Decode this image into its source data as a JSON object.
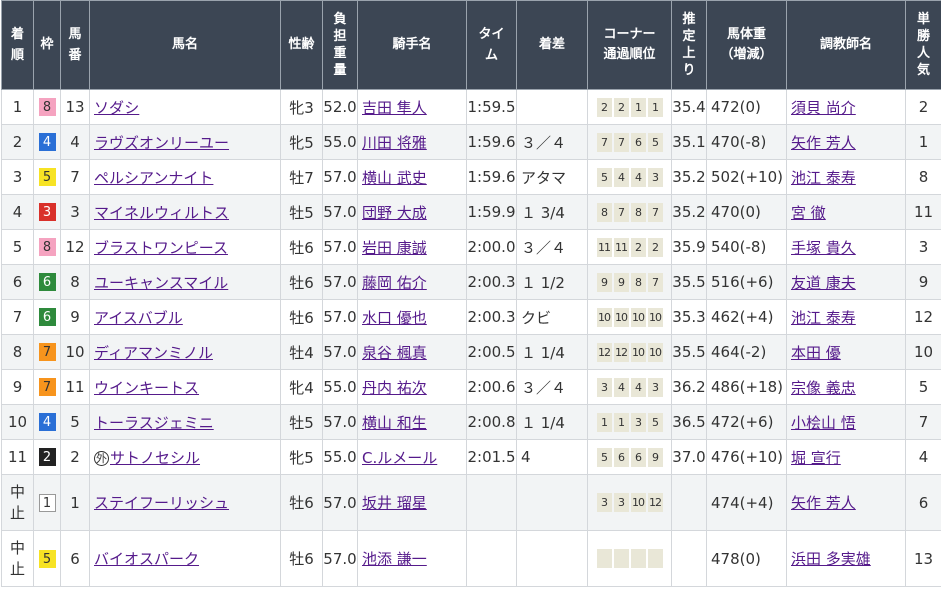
{
  "headers": {
    "chakujun": [
      "着",
      "順"
    ],
    "waku": "枠",
    "umaban": [
      "馬",
      "番"
    ],
    "bamei": "馬名",
    "seirei": "性齢",
    "futan": [
      "負",
      "担",
      "重",
      "量"
    ],
    "kishu": "騎手名",
    "time": [
      "タイ",
      "ム"
    ],
    "chakusa": "着差",
    "corner": [
      "コーナー",
      "通過順位"
    ],
    "agari": [
      "推",
      "定",
      "上",
      "り"
    ],
    "bataiju": [
      "馬体重",
      "（増減）"
    ],
    "chokyoshi": "調教師名",
    "ninki": [
      "単",
      "勝",
      "人",
      "気"
    ]
  },
  "rows": [
    {
      "chakujun": "1",
      "waku": "8",
      "umaban": "13",
      "mark": "",
      "bamei": "ソダシ",
      "seirei": "牝3",
      "futan": "52.0",
      "kishu": "吉田 隼人",
      "time": "1:59.5",
      "chakusa": "",
      "corner": [
        "2",
        "2",
        "1",
        "1"
      ],
      "agari": "35.4",
      "bataiju": "472(0)",
      "chokyoshi": "須貝 尚介",
      "ninki": "2"
    },
    {
      "chakujun": "2",
      "waku": "4",
      "umaban": "4",
      "mark": "",
      "bamei": "ラヴズオンリーユー",
      "seirei": "牝5",
      "futan": "55.0",
      "kishu": "川田 将雅",
      "time": "1:59.6",
      "chakusa": "３／４",
      "corner": [
        "7",
        "7",
        "6",
        "5"
      ],
      "agari": "35.1",
      "bataiju": "470(-8)",
      "chokyoshi": "矢作 芳人",
      "ninki": "1"
    },
    {
      "chakujun": "3",
      "waku": "5",
      "umaban": "7",
      "mark": "",
      "bamei": "ペルシアンナイト",
      "seirei": "牡7",
      "futan": "57.0",
      "kishu": "横山 武史",
      "time": "1:59.6",
      "chakusa": "アタマ",
      "corner": [
        "5",
        "4",
        "4",
        "3"
      ],
      "agari": "35.2",
      "bataiju": "502(+10)",
      "chokyoshi": "池江 泰寿",
      "ninki": "8"
    },
    {
      "chakujun": "4",
      "waku": "3",
      "umaban": "3",
      "mark": "",
      "bamei": "マイネルウィルトス",
      "seirei": "牡5",
      "futan": "57.0",
      "kishu": "団野 大成",
      "time": "1:59.9",
      "chakusa": "１ 3/4",
      "corner": [
        "8",
        "7",
        "8",
        "7"
      ],
      "agari": "35.2",
      "bataiju": "470(0)",
      "chokyoshi": "宮 徹",
      "ninki": "11"
    },
    {
      "chakujun": "5",
      "waku": "8",
      "umaban": "12",
      "mark": "",
      "bamei": "ブラストワンピース",
      "seirei": "牡6",
      "futan": "57.0",
      "kishu": "岩田 康誠",
      "time": "2:00.0",
      "chakusa": "３／４",
      "corner": [
        "11",
        "11",
        "2",
        "2"
      ],
      "agari": "35.9",
      "bataiju": "540(-8)",
      "chokyoshi": "手塚 貴久",
      "ninki": "3"
    },
    {
      "chakujun": "6",
      "waku": "6",
      "umaban": "8",
      "mark": "",
      "bamei": "ユーキャンスマイル",
      "seirei": "牡6",
      "futan": "57.0",
      "kishu": "藤岡 佑介",
      "time": "2:00.3",
      "chakusa": "１ 1/2",
      "corner": [
        "9",
        "9",
        "8",
        "7"
      ],
      "agari": "35.5",
      "bataiju": "516(+6)",
      "chokyoshi": "友道 康夫",
      "ninki": "9"
    },
    {
      "chakujun": "7",
      "waku": "6",
      "umaban": "9",
      "mark": "",
      "bamei": "アイスバブル",
      "seirei": "牡6",
      "futan": "57.0",
      "kishu": "水口 優也",
      "time": "2:00.3",
      "chakusa": "クビ",
      "corner": [
        "10",
        "10",
        "10",
        "10"
      ],
      "agari": "35.3",
      "bataiju": "462(+4)",
      "chokyoshi": "池江 泰寿",
      "ninki": "12"
    },
    {
      "chakujun": "8",
      "waku": "7",
      "umaban": "10",
      "mark": "",
      "bamei": "ディアマンミノル",
      "seirei": "牡4",
      "futan": "57.0",
      "kishu": "泉谷 楓真",
      "time": "2:00.5",
      "chakusa": "１ 1/4",
      "corner": [
        "12",
        "12",
        "10",
        "10"
      ],
      "agari": "35.5",
      "bataiju": "464(-2)",
      "chokyoshi": "本田 優",
      "ninki": "10"
    },
    {
      "chakujun": "9",
      "waku": "7",
      "umaban": "11",
      "mark": "",
      "bamei": "ウインキートス",
      "seirei": "牝4",
      "futan": "55.0",
      "kishu": "丹内 祐次",
      "time": "2:00.6",
      "chakusa": "３／４",
      "corner": [
        "3",
        "4",
        "4",
        "3"
      ],
      "agari": "36.2",
      "bataiju": "486(+18)",
      "chokyoshi": "宗像 義忠",
      "ninki": "5"
    },
    {
      "chakujun": "10",
      "waku": "4",
      "umaban": "5",
      "mark": "",
      "bamei": "トーラスジェミニ",
      "seirei": "牡5",
      "futan": "57.0",
      "kishu": "横山 和生",
      "time": "2:00.8",
      "chakusa": "１ 1/4",
      "corner": [
        "1",
        "1",
        "3",
        "5"
      ],
      "agari": "36.5",
      "bataiju": "472(+6)",
      "chokyoshi": "小桧山 悟",
      "ninki": "7"
    },
    {
      "chakujun": "11",
      "waku": "2",
      "umaban": "2",
      "mark": "外",
      "bamei": "サトノセシル",
      "seirei": "牝5",
      "futan": "55.0",
      "kishu": "C.ルメール",
      "time": "2:01.5",
      "chakusa": "4",
      "corner": [
        "5",
        "6",
        "6",
        "9"
      ],
      "agari": "37.0",
      "bataiju": "476(+10)",
      "chokyoshi": "堀 宣行",
      "ninki": "4"
    },
    {
      "chakujun": [
        "中",
        "止"
      ],
      "waku": "1",
      "umaban": "1",
      "mark": "",
      "bamei": "ステイフーリッシュ",
      "seirei": "牡6",
      "futan": "57.0",
      "kishu": "坂井 瑠星",
      "time": "",
      "chakusa": "",
      "corner": [
        "3",
        "3",
        "10",
        "12"
      ],
      "agari": "",
      "bataiju": "474(+4)",
      "chokyoshi": "矢作 芳人",
      "ninki": "6"
    },
    {
      "chakujun": [
        "中",
        "止"
      ],
      "waku": "5",
      "umaban": "6",
      "mark": "",
      "bamei": "バイオスパーク",
      "seirei": "牡6",
      "futan": "57.0",
      "kishu": "池添 謙一",
      "time": "",
      "chakusa": "",
      "corner": [
        "",
        "",
        "",
        ""
      ],
      "agari": "",
      "bataiju": "478(0)",
      "chokyoshi": "浜田 多実雄",
      "ninki": "13"
    }
  ],
  "colors": {
    "header_bg": "#3c4654",
    "link": "#551a8b",
    "corner_chip": "#e9e7d7",
    "waku": {
      "1": "#ffffff",
      "2": "#222222",
      "3": "#d9302a",
      "4": "#2a6fd6",
      "5": "#f7e324",
      "6": "#2e8a3c",
      "7": "#f7941d",
      "8": "#f5a3c0"
    }
  }
}
